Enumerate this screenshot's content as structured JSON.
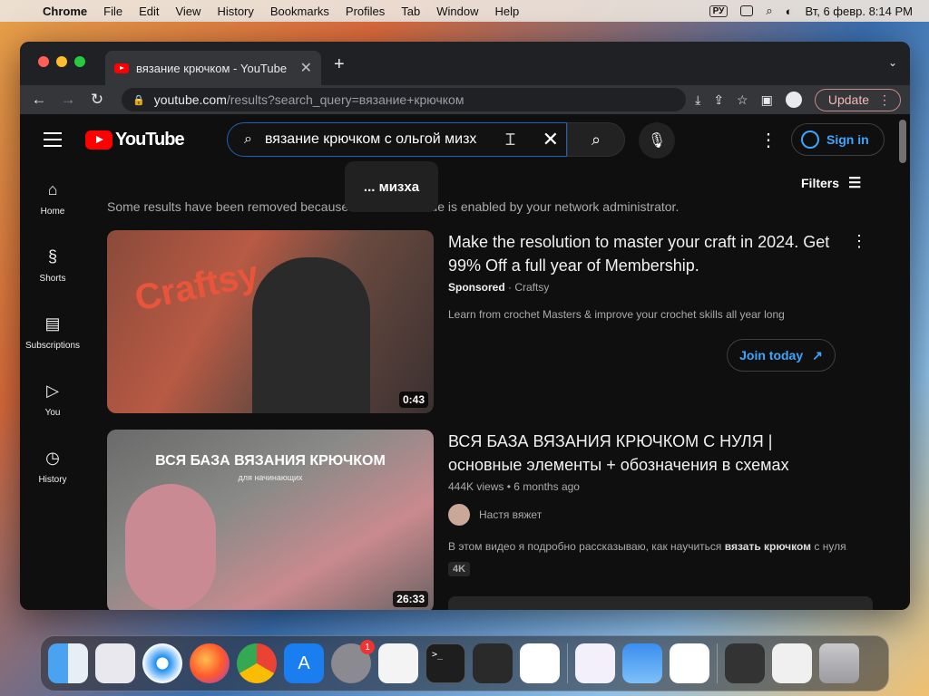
{
  "menubar": {
    "app": "Chrome",
    "items": [
      "File",
      "Edit",
      "View",
      "History",
      "Bookmarks",
      "Profiles",
      "Tab",
      "Window",
      "Help"
    ],
    "lang": "РУ",
    "datetime": "Вт, 6 февр.  8:14 PM"
  },
  "browser": {
    "tab_title": "вязание крючком - YouTube",
    "url_host": "youtube.com",
    "url_path": "/results?search_query=вязание+крючком",
    "update_label": "Update"
  },
  "youtube": {
    "logo_text": "YouTube",
    "search_value": "вязание крючком с ольгой мизх",
    "suggestion": "... мизха",
    "signin_label": "Sign in",
    "filters_label": "Filters",
    "notice": "Some results have been removed because Restricted Mode is enabled by your network administrator.",
    "sidebar": [
      {
        "label": "Home",
        "icon": "home-icon"
      },
      {
        "label": "Shorts",
        "icon": "shorts-icon"
      },
      {
        "label": "Subscriptions",
        "icon": "subscriptions-icon"
      },
      {
        "label": "You",
        "icon": "library-icon"
      },
      {
        "label": "History",
        "icon": "history-icon"
      }
    ],
    "results": [
      {
        "title": "Make the resolution to master your craft in 2024. Get 99% Off a full year of Membership.",
        "sponsored": "Sponsored",
        "channel": "Craftsy",
        "description": "Learn from crochet Masters & improve your crochet skills all year long",
        "duration": "0:43",
        "cta": "Join today",
        "thumb_text": "Craftsy"
      },
      {
        "title": "ВСЯ БАЗА ВЯЗАНИЯ КРЮЧКОМ С НУЛЯ | основные элементы + обозначения в схемах",
        "views": "444K views",
        "age": "6 months ago",
        "channel": "Настя вяжет",
        "description_pre": "В этом видео я подробно рассказываю, как научиться ",
        "description_bold": "вязать крючком",
        "description_post": " с нуля. З...",
        "badge": "4K",
        "duration": "26:33",
        "thumb_title": "ВСЯ БАЗА ВЯЗАНИЯ КРЮЧКОМ",
        "thumb_sub": "для начинающих"
      }
    ]
  },
  "dock": {
    "settings_badge": "1",
    "apps": [
      "Finder",
      "Launchpad",
      "Safari",
      "Firefox",
      "Google Chrome",
      "App Store",
      "System Settings",
      "TextEdit",
      "Terminal",
      "GarageBand",
      "Visual Studio Code",
      "Visual Studio",
      "Weather",
      "Freeform",
      "Screens",
      "Preview",
      "Trash"
    ]
  }
}
